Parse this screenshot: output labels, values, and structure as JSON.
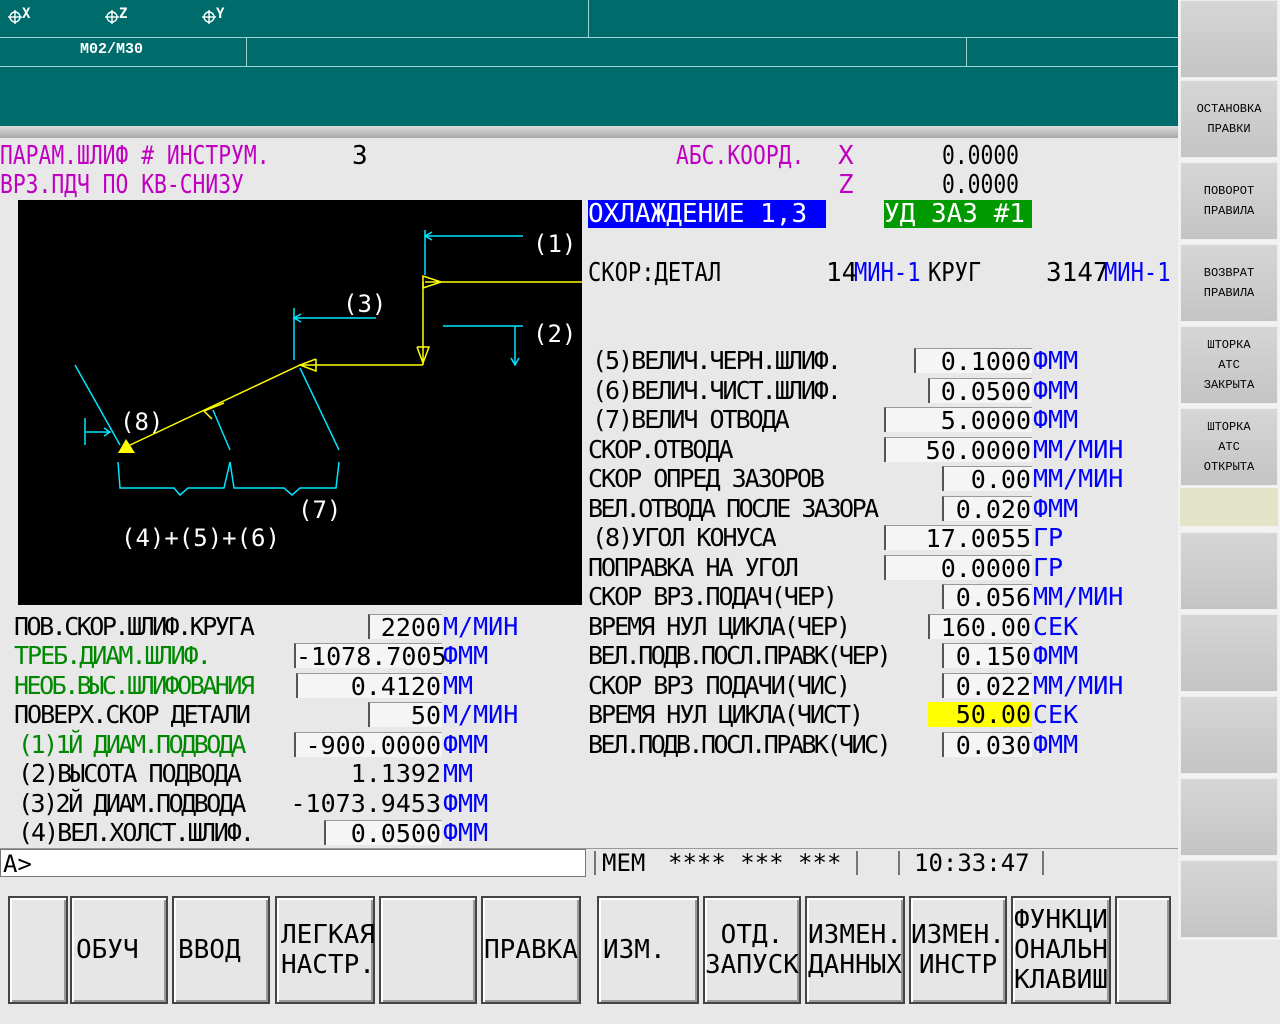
{
  "header": {
    "axis_icons": [
      "X",
      "Z",
      "Y"
    ],
    "mode": "M02/M30"
  },
  "right_keys": [
    {
      "label": "ОСТАНОВКА\nПРАВКИ"
    },
    {
      "label": "ПОВОРОТ\nПРАВИЛА"
    },
    {
      "label": "ВОЗВРАТ\nПРАВИЛА"
    },
    {
      "label": "ШТОРКА\nАТС\nЗАКРЫТА"
    },
    {
      "label": "ШТОРКА\nАТС\nОТКРЫТА"
    }
  ],
  "title": {
    "line1_left": "ПАРАМ.ШЛИФ # ИНСТРУМ.",
    "tool_number": "3",
    "line2_left": "ВРЗ.ПДЧ ПО КВ-СНИЗУ",
    "abs_label": "АБС.КООРД.",
    "x_label": "X",
    "x_value": "0.0000",
    "z_label": "Z",
    "z_value": "0.0000"
  },
  "status_badges": {
    "coolant": "ОХЛАЖДЕНИЕ 1,3",
    "gap": "УД ЗАЗ #1"
  },
  "speed_line": {
    "label": "СКОР:ДЕТАЛ",
    "part_value": "14",
    "part_unit": "МИН-1",
    "wheel_label": "КРУГ",
    "wheel_value": "3147",
    "wheel_unit": "МИН-1"
  },
  "diagram_labels": {
    "l1": "(1)",
    "l2": "(2)",
    "l3": "(3)",
    "l7": "(7)",
    "l8": "(8)",
    "sum": "(4)+(5)+(6)"
  },
  "right_params": [
    {
      "label": "(5)ВЕЛИЧ.ЧЕРН.ШЛИФ.",
      "value": "0.1000",
      "unit": "ФММ"
    },
    {
      "label": "(6)ВЕЛИЧ.ЧИСТ.ШЛИФ.",
      "value": "0.0500",
      "unit": "ФММ"
    },
    {
      "label": "(7)ВЕЛИЧ ОТВОДА",
      "value": "5.0000",
      "unit": "ФММ"
    },
    {
      "label": "СКОР.ОТВОДА",
      "value": "50.0000",
      "unit": "ММ/МИН"
    },
    {
      "label": "СКОР ОПРЕД ЗАЗОРОВ",
      "value": "0.00",
      "unit": "ММ/МИН"
    },
    {
      "label": "ВЕЛ.ОТВОДА ПОСЛЕ ЗАЗОРА",
      "value": "0.020",
      "unit": "ФММ"
    },
    {
      "label": "(8)УГОЛ КОНУСА",
      "value": "17.0055",
      "unit": "ГР"
    },
    {
      "label": "ПОПРАВКА НА УГОЛ",
      "value": "0.0000",
      "unit": "ГР"
    },
    {
      "label": "СКОР ВРЗ.ПОДАЧ(ЧЕР)",
      "value": "0.056",
      "unit": "ММ/МИН"
    },
    {
      "label": "ВРЕМЯ НУЛ ЦИКЛА(ЧЕР)",
      "value": "160.00",
      "unit": "СЕК"
    },
    {
      "label": "ВЕЛ.ПОДВ.ПОСЛ.ПРАВК(ЧЕР)",
      "value": "0.150",
      "unit": "ФММ"
    },
    {
      "label": "СКОР ВРЗ ПОДАЧИ(ЧИС)",
      "value": "0.022",
      "unit": "ММ/МИН"
    },
    {
      "label": "ВРЕМЯ НУЛ ЦИКЛА(ЧИСТ)",
      "value": "50.00",
      "unit": "СЕК"
    },
    {
      "label": "ВЕЛ.ПОДВ.ПОСЛ.ПРАВК(ЧИС)",
      "value": "0.030",
      "unit": "ФММ"
    }
  ],
  "left_params": [
    {
      "label": "ПОВ.СКОР.ШЛИФ.КРУГА",
      "value": "2200",
      "unit": "М/МИН"
    },
    {
      "label": "ТРЕБ.ДИАМ.ШЛИФ.",
      "value": "-1078.7005",
      "unit": "ФММ"
    },
    {
      "label": "НЕОБ.ВЫС.ШЛИФОВАНИЯ",
      "value": "0.4120",
      "unit": "ММ"
    },
    {
      "label": "ПОВЕРХ.СКОР ДЕТАЛИ",
      "value": "50",
      "unit": "М/МИН"
    },
    {
      "label": "(1)1Й ДИАМ.ПОДВОДА",
      "value": "-900.0000",
      "unit": "ФММ"
    },
    {
      "label": "(2)ВЫСОТА ПОДВОДА",
      "value": "1.1392",
      "unit": "ММ"
    },
    {
      "label": "(3)2Й ДИАМ.ПОДВОДА",
      "value": "-1073.9453",
      "unit": "ФММ"
    },
    {
      "label": "(4)ВЕЛ.ХОЛСТ.ШЛИФ.",
      "value": "0.0500",
      "unit": "ФММ"
    }
  ],
  "status": {
    "prompt": "A>",
    "mode": "MEM",
    "flags": "**** *** ***",
    "time": "10:33:47"
  },
  "bottom_keys": [
    {
      "label": ""
    },
    {
      "label": "ОБУЧ"
    },
    {
      "label": "ВВОД"
    },
    {
      "label": "ЛЕГКАЯ\nНАСТР."
    },
    {
      "label": ""
    },
    {
      "label": "ПРАВКА"
    },
    {
      "label": "ИЗМ."
    },
    {
      "label": "ОТД.\nЗАПУСК"
    },
    {
      "label": "ИЗМЕН.\nДАННЫХ"
    },
    {
      "label": "ИЗМЕН.\nИНСТР"
    },
    {
      "label": "ФУНКЦИ\nОНАЛЬН\nКЛАВИШ"
    },
    {
      "label": ""
    }
  ],
  "colors": {
    "header_bg": "#006b6b",
    "label_magenta": "#c000c0",
    "label_green": "#008800",
    "unit_blue": "#0000ff",
    "highlight_yellow": "#ffff00",
    "diagram_cyan": "#00e5ff",
    "diagram_yellow": "#ffff00"
  }
}
